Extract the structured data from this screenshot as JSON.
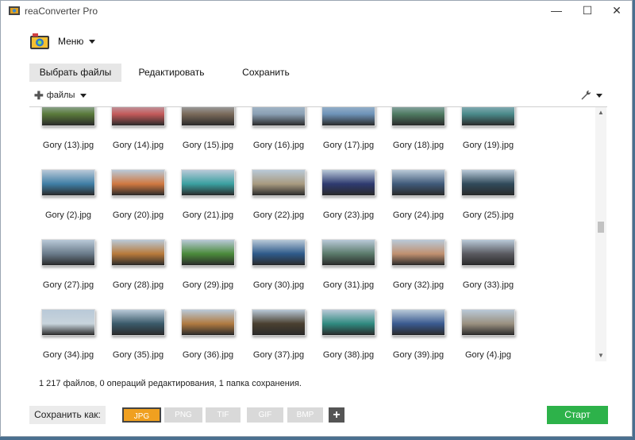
{
  "window": {
    "title": "reaConverter Pro",
    "controls": {
      "minimize": "—",
      "maximize": "☐",
      "close": "✕"
    }
  },
  "menu": {
    "label": "Меню"
  },
  "tabs": [
    {
      "label": "Выбрать файлы",
      "active": true
    },
    {
      "label": "Редактировать",
      "active": false
    },
    {
      "label": "Сохранить",
      "active": false
    }
  ],
  "toolbar": {
    "files_label": "файлы",
    "wrench_icon": "wrench-icon"
  },
  "gallery": {
    "rows": [
      [
        "Gory (13).jpg",
        "Gory (14).jpg",
        "Gory (15).jpg",
        "Gory (16).jpg",
        "Gory (17).jpg",
        "Gory (18).jpg",
        "Gory (19).jpg"
      ],
      [
        "Gory (2).jpg",
        "Gory (20).jpg",
        "Gory (21).jpg",
        "Gory (22).jpg",
        "Gory (23).jpg",
        "Gory (24).jpg",
        "Gory (25).jpg"
      ],
      [
        "Gory (27).jpg",
        "Gory (28).jpg",
        "Gory (29).jpg",
        "Gory (30).jpg",
        "Gory (31).jpg",
        "Gory (32).jpg",
        "Gory (33).jpg"
      ],
      [
        "Gory (34).jpg",
        "Gory (35).jpg",
        "Gory (36).jpg",
        "Gory (37).jpg",
        "Gory (38).jpg",
        "Gory (39).jpg",
        "Gory (4).jpg"
      ]
    ],
    "thumb_colors": [
      [
        "#5a7a3a",
        "#c45a5a",
        "#7a6a5a",
        "#8aa0b4",
        "#6e93b8",
        "#4f7b62",
        "#4a8a8a"
      ],
      [
        "#3f7ea5",
        "#d07840",
        "#3aa0a0",
        "#a89a80",
        "#2e3a70",
        "#405a7a",
        "#304a5a"
      ],
      [
        "#6a7b8a",
        "#b87a3a",
        "#4a8a3a",
        "#2e5a8a",
        "#5a7a6a",
        "#c09070",
        "#5a5a60"
      ],
      [
        "#c8d4dc",
        "#3a5a6a",
        "#b07a40",
        "#4a4030",
        "#2f8a80",
        "#3a5a90",
        "#9a9080"
      ]
    ]
  },
  "scrollbar": {
    "up": "▲",
    "down": "▼"
  },
  "status": "1 217 файлов, 0 операций редактирования, 1 папка сохранения.",
  "save_as_label": "Сохранить как:",
  "formats": [
    {
      "label": "JPG",
      "selected": true
    },
    {
      "label": "PNG",
      "selected": false
    },
    {
      "label": "TIF",
      "selected": false
    },
    {
      "label": "GIF",
      "selected": false
    },
    {
      "label": "BMP",
      "selected": false
    }
  ],
  "add_format": "+",
  "start_label": "Старт",
  "colors": {
    "accent_orange": "#f0a020",
    "start_green": "#2db24a"
  }
}
